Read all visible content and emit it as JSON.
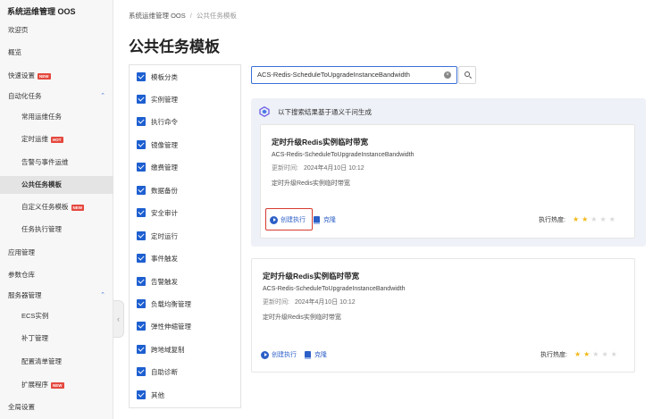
{
  "sidebar": {
    "title": "系统运维管理 OOS",
    "items": [
      {
        "label": "欢迎页"
      },
      {
        "label": "概览"
      },
      {
        "label": "快速设置",
        "badge": "NEW"
      },
      {
        "label": "自动化任务",
        "chevron": "up"
      },
      {
        "label": "常用运维任务"
      },
      {
        "label": "定时运维",
        "badge": "HOT"
      },
      {
        "label": "告警与事件运维"
      },
      {
        "label": "公共任务模板"
      },
      {
        "label": "自定义任务模板",
        "badge": "NEW"
      },
      {
        "label": "任务执行管理"
      },
      {
        "label": "应用管理"
      },
      {
        "label": "参数仓库"
      },
      {
        "label": "服务器管理",
        "chevron": "up"
      },
      {
        "label": "ECS实例"
      },
      {
        "label": "补丁管理"
      },
      {
        "label": "配置清单管理"
      },
      {
        "label": "扩展程序",
        "badge": "NEW"
      },
      {
        "label": "全局设置"
      }
    ]
  },
  "breadcrumb": {
    "root": "系统运维管理 OOS",
    "separator": "/",
    "current": "公共任务模板"
  },
  "page": {
    "title": "公共任务模板"
  },
  "categories": [
    {
      "label": "模板分类",
      "checked": true
    },
    {
      "label": "实例管理",
      "checked": true
    },
    {
      "label": "执行命令",
      "checked": true
    },
    {
      "label": "镜像管理",
      "checked": true
    },
    {
      "label": "缴费管理",
      "checked": true
    },
    {
      "label": "数据备份",
      "checked": true
    },
    {
      "label": "安全审计",
      "checked": true
    },
    {
      "label": "定时运行",
      "checked": true
    },
    {
      "label": "事件触发",
      "checked": true
    },
    {
      "label": "告警触发",
      "checked": true
    },
    {
      "label": "负载均衡管理",
      "checked": true
    },
    {
      "label": "弹性伸缩管理",
      "checked": true
    },
    {
      "label": "跨地域复制",
      "checked": true
    },
    {
      "label": "自助诊断",
      "checked": true
    },
    {
      "label": "其他",
      "checked": true
    }
  ],
  "search": {
    "value": "ACS-Redis-ScheduleToUpgradeInstanceBandwidth",
    "clear_icon": "clear-icon",
    "button_icon": "search-icon"
  },
  "ai_panel": {
    "header": "以下搜索结果基于通义千问生成"
  },
  "cards": [
    {
      "title": "定时升级Redis实例临时带宽",
      "code": "ACS-Redis-ScheduleToUpgradeInstanceBandwidth",
      "updated_label": "更新时间:",
      "updated_value": "2024年4月10日 10:12",
      "description": "定时升级Redis实例临时带宽",
      "execute_label": "创建执行",
      "clone_label": "克隆",
      "heat_label": "执行热度:",
      "heat": 2,
      "heat_max": 5,
      "execute_highlighted": true
    },
    {
      "title": "定时升级Redis实例临时带宽",
      "code": "ACS-Redis-ScheduleToUpgradeInstanceBandwidth",
      "updated_label": "更新时间:",
      "updated_value": "2024年4月10日 10:12",
      "description": "定时升级Redis实例临时带宽",
      "execute_label": "创建执行",
      "clone_label": "克隆",
      "heat_label": "执行热度:",
      "heat": 2,
      "heat_max": 5,
      "execute_highlighted": false
    }
  ],
  "colors": {
    "accent": "#2c5fc7",
    "checkbox": "#1d5fd0",
    "badge": "#e5483e",
    "highlight": "#d63a2e",
    "star_on": "#f2b918",
    "star_off": "#d9d9d9",
    "ai_panel_bg": "#eef1f7"
  }
}
